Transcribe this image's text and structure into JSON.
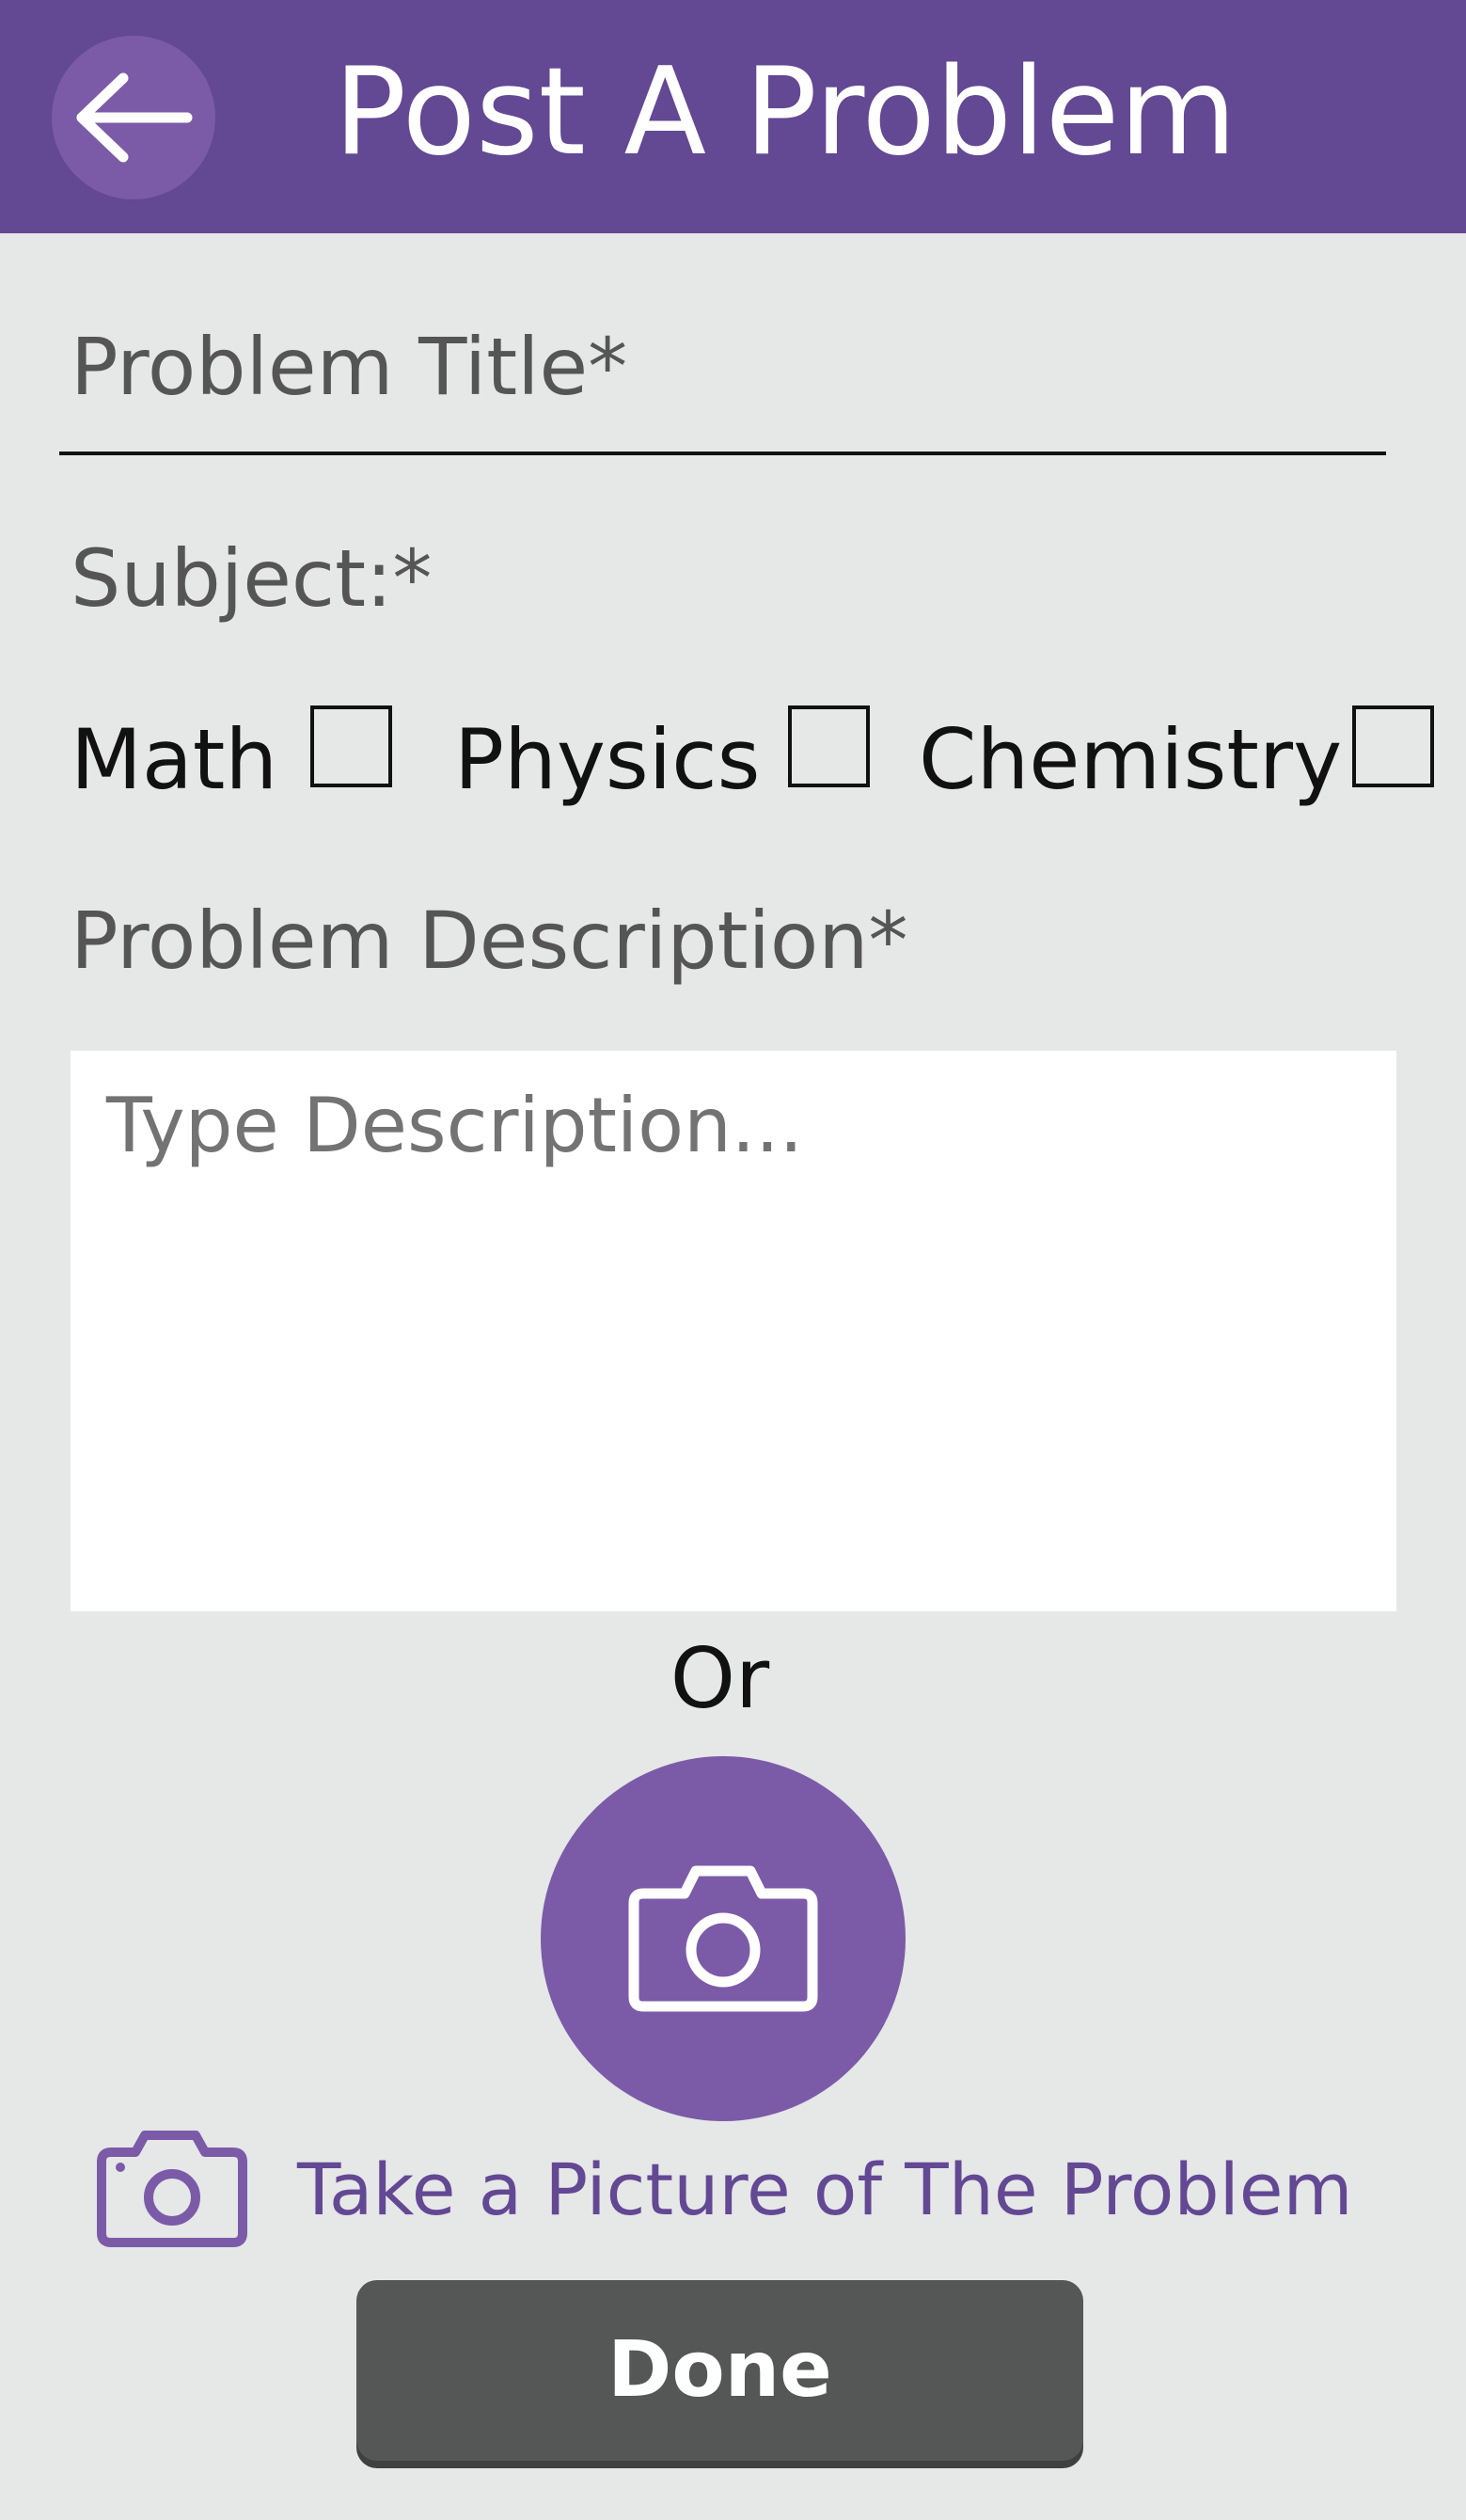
{
  "header": {
    "title": "Post A Problem",
    "back_icon": "arrow-left-icon",
    "background_color": "#634893"
  },
  "form": {
    "title_field": {
      "placeholder": "Problem Title*",
      "value": ""
    },
    "subject": {
      "label": "Subject:*",
      "options": [
        {
          "label": "Math",
          "checked": false
        },
        {
          "label": "Physics",
          "checked": false
        },
        {
          "label": "Chemistry",
          "checked": false
        }
      ]
    },
    "description": {
      "label": "Problem Description*",
      "placeholder": "Type Description...",
      "value": ""
    },
    "or_label": "Or",
    "camera": {
      "icon": "camera-icon",
      "color": "#7b5ba8"
    },
    "take_picture": {
      "label": "Take a Picture of The Problem",
      "icon": "camera-icon"
    },
    "done_label": "Done"
  }
}
